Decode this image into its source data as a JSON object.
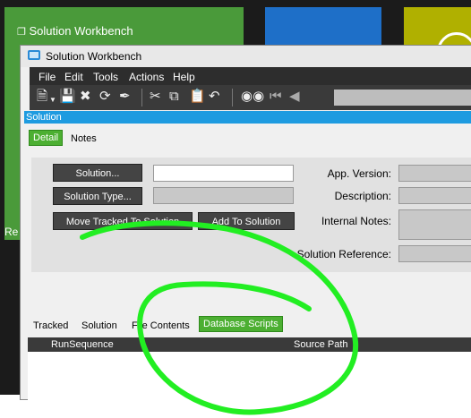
{
  "background": {
    "tile_green_title": "Solution Workbench",
    "tile_green_partial": "Re",
    "tile_icon": "window-icon"
  },
  "window": {
    "title": "Solution Workbench",
    "title_icon": "app-window-icon"
  },
  "menu": [
    "File",
    "Edit",
    "Tools",
    "Actions",
    "Help"
  ],
  "toolbar_icons": [
    "new-icon",
    "dropdown-arrow-icon",
    "save-icon",
    "delete-icon",
    "refresh-icon",
    "clear-icon",
    "cut-icon",
    "copy-icon",
    "paste-icon",
    "undo-icon",
    "binoculars-icon",
    "first-record-icon",
    "previous-record-icon"
  ],
  "section": {
    "title": "Solution"
  },
  "tabs": {
    "detail": "Detail",
    "notes": "Notes"
  },
  "form": {
    "solution_button": "Solution...",
    "solution_value": "",
    "solution_type_button": "Solution Type...",
    "solution_type_value": "",
    "move_tracked_button": "Move Tracked To Solution",
    "add_button": "Add To Solution",
    "app_version_label": "App. Version:",
    "app_version_value": "",
    "description_label": "Description:",
    "description_value": "",
    "internal_notes_label": "Internal Notes:",
    "internal_notes_value": "",
    "solution_reference_label": "Solution Reference:",
    "solution_reference_value": ""
  },
  "bottom_tabs": {
    "tracked": "Tracked",
    "solution": "Solution",
    "file_contents": "File Contents",
    "database_scripts": "Database Scripts"
  },
  "grid": {
    "columns": [
      "RunSequence",
      "Source Path"
    ]
  },
  "colors": {
    "accent_green": "#4caf32",
    "section_blue": "#1e9be0",
    "annotation": "#22ee22"
  }
}
